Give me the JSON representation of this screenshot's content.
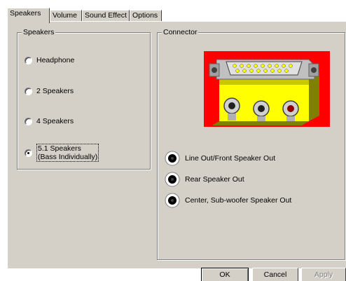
{
  "tabs": [
    {
      "label": "Speakers"
    },
    {
      "label": "Volume"
    },
    {
      "label": "Sound Effect"
    },
    {
      "label": "Options"
    }
  ],
  "speakers_group": {
    "title": "Speakers",
    "options": [
      {
        "label": "Headphone",
        "checked": false
      },
      {
        "label": "2 Speakers",
        "checked": false
      },
      {
        "label": "4 Speakers",
        "checked": false
      },
      {
        "label_line1": "5.1 Speakers",
        "label_line2": "(Bass Individually)",
        "checked": true
      }
    ]
  },
  "connector_group": {
    "title": "Connector",
    "jacks": [
      {
        "label": "Line Out/Front Speaker Out",
        "icon": "black-jack-icon"
      },
      {
        "label": "Rear Speaker Out",
        "icon": "black-jack-icon"
      },
      {
        "label": "Center, Sub-woofer Speaker Out",
        "icon": "black-jack-icon"
      }
    ],
    "image_colors": {
      "background": "#ff0000",
      "block": "#ffff00",
      "metal": "#c0c0c0"
    }
  },
  "buttons": {
    "ok": "OK",
    "cancel": "Cancel",
    "apply": "Apply"
  }
}
